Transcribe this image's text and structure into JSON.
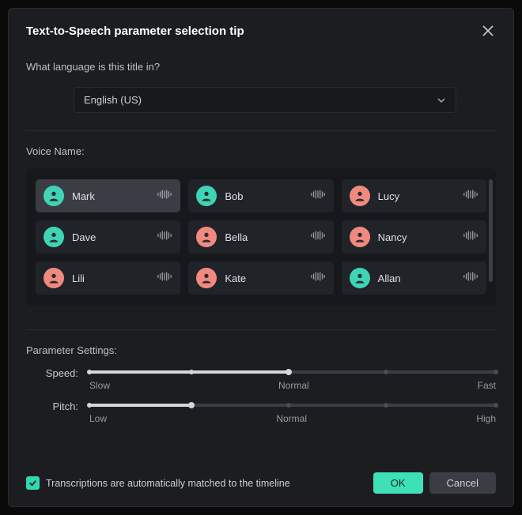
{
  "dialog": {
    "title": "Text-to-Speech parameter selection tip",
    "question": "What language is this title in?",
    "language_selected": "English (US)"
  },
  "voice_section": {
    "label": "Voice Name:",
    "voices": [
      {
        "name": "Mark",
        "gender": "male",
        "selected": true
      },
      {
        "name": "Bob",
        "gender": "male",
        "selected": false
      },
      {
        "name": "Lucy",
        "gender": "female",
        "selected": false
      },
      {
        "name": "Dave",
        "gender": "male",
        "selected": false
      },
      {
        "name": "Bella",
        "gender": "female",
        "selected": false
      },
      {
        "name": "Nancy",
        "gender": "female",
        "selected": false
      },
      {
        "name": "Lili",
        "gender": "female",
        "selected": false
      },
      {
        "name": "Kate",
        "gender": "female",
        "selected": false
      },
      {
        "name": "Allan",
        "gender": "male",
        "selected": false
      }
    ]
  },
  "params": {
    "section_label": "Parameter Settings:",
    "speed": {
      "label": "Speed:",
      "value_pct": 49,
      "ticks": [
        "Slow",
        "Normal",
        "Fast"
      ]
    },
    "pitch": {
      "label": "Pitch:",
      "value_pct": 25,
      "ticks": [
        "Low",
        "Normal",
        "High"
      ]
    }
  },
  "footer": {
    "checkbox_label": "Transcriptions are automatically matched to the timeline",
    "checked": true,
    "ok": "OK",
    "cancel": "Cancel"
  }
}
